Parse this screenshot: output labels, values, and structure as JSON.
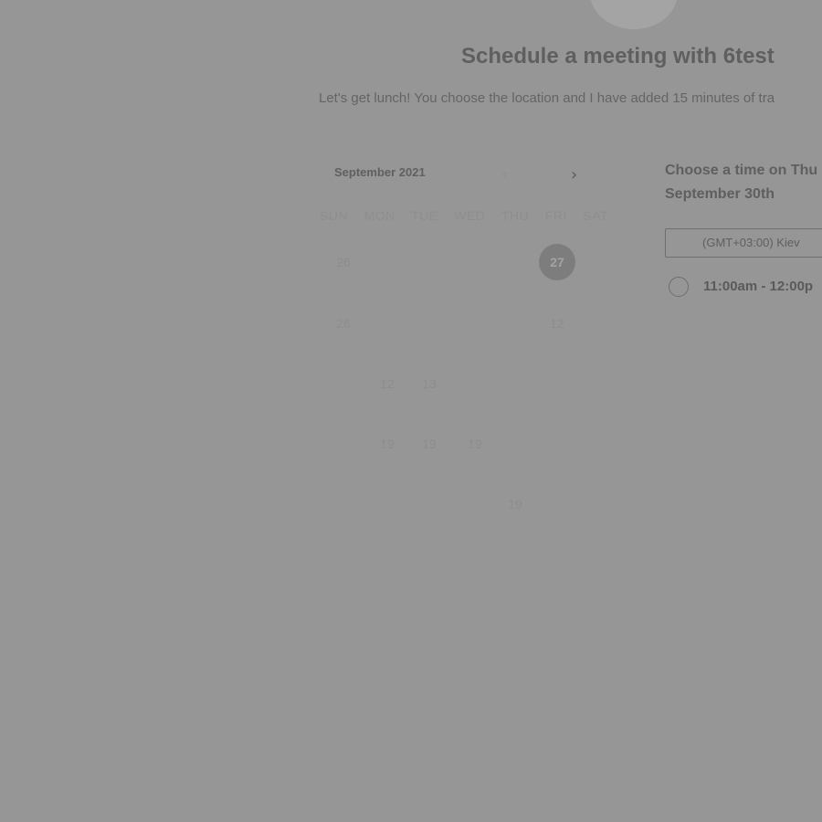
{
  "header": {
    "title": "Schedule a meeting with 6test",
    "description": "Let's get lunch! You choose the location and I have added 15 minutes of tra"
  },
  "calendar": {
    "month_label": "September 2021",
    "prev_icon": "‹",
    "next_icon": "›",
    "weekdays": [
      "SUN",
      "MON",
      "TUE",
      "WED",
      "THU",
      "FRI",
      "SAT"
    ],
    "visible_days": [
      "26",
      "27",
      "26",
      "12",
      "12",
      "13",
      "19",
      "19",
      "19",
      "19"
    ],
    "selected_day": "27"
  },
  "timepicker": {
    "heading": "Choose a time on Thu September 30th",
    "timezone": "(GMT+03:00) Kiev",
    "slots": [
      {
        "label": "11:00am - 12:00p"
      }
    ]
  }
}
